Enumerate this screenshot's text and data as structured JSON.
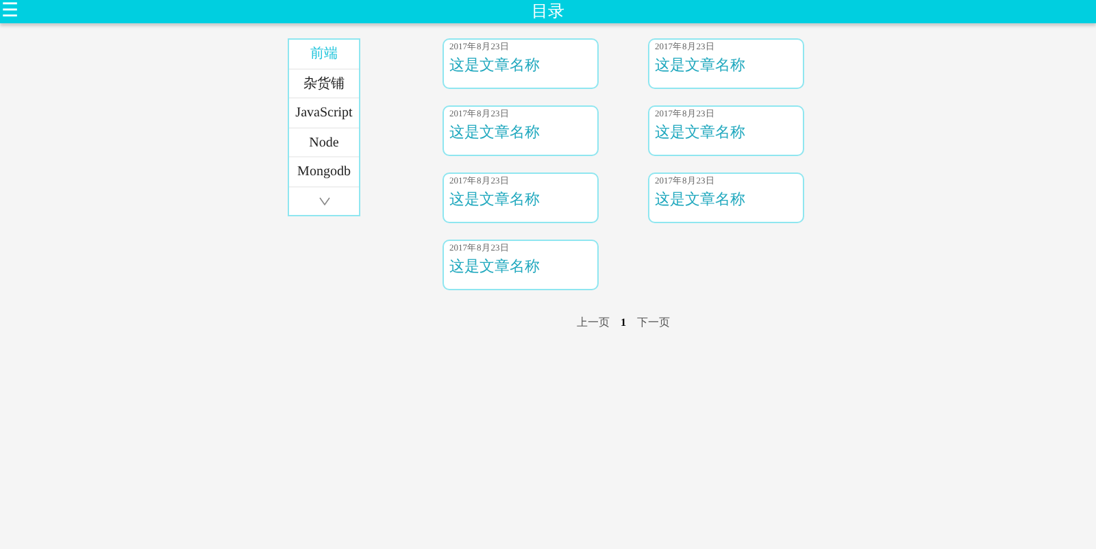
{
  "header": {
    "menu_icon": "☰",
    "title": "目录"
  },
  "sidebar": {
    "items": [
      {
        "label": "前端",
        "selected": true
      },
      {
        "label": "杂货铺",
        "selected": false
      },
      {
        "label": "JavaScript",
        "selected": false
      },
      {
        "label": "Node",
        "selected": false
      },
      {
        "label": "Mongodb",
        "selected": false
      }
    ]
  },
  "articles": [
    {
      "date": "2017年8月23日",
      "title": "这是文章名称"
    },
    {
      "date": "2017年8月23日",
      "title": "这是文章名称"
    },
    {
      "date": "2017年8月23日",
      "title": "这是文章名称"
    },
    {
      "date": "2017年8月23日",
      "title": "这是文章名称"
    },
    {
      "date": "2017年8月23日",
      "title": "这是文章名称"
    },
    {
      "date": "2017年8月23日",
      "title": "这是文章名称"
    },
    {
      "date": "2017年8月23日",
      "title": "这是文章名称"
    }
  ],
  "pagination": {
    "prev": "上一页",
    "pages": [
      {
        "label": "1",
        "selected": true
      }
    ],
    "next": "下一页"
  }
}
